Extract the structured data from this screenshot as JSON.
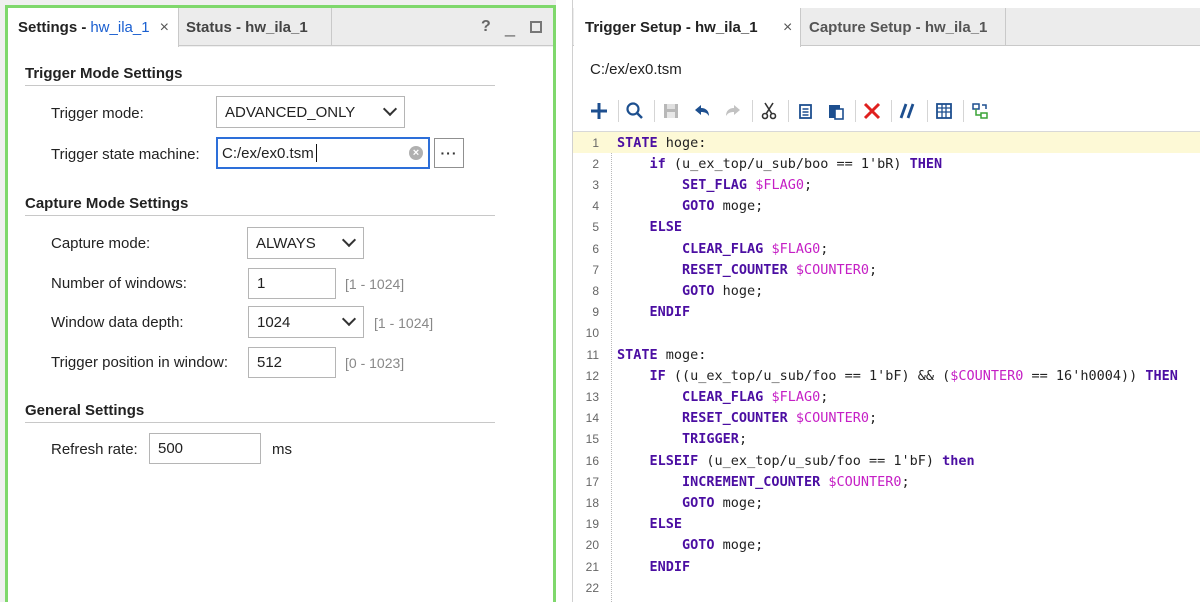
{
  "left": {
    "tabs": {
      "settings_bold": "Settings - ",
      "settings_link": "hw_ila_1",
      "settings_close": "×",
      "status": "Status - hw_ila_1"
    },
    "window_controls": {
      "help": "?",
      "minimize": "_",
      "maximize": ""
    },
    "trigger_mode_settings": {
      "title": "Trigger Mode Settings",
      "trigger_mode_label": "Trigger mode:",
      "trigger_mode_value": "ADVANCED_ONLY",
      "tsm_label": "Trigger state machine:",
      "tsm_value": "C:/ex/ex0.tsm",
      "tsm_clear": "×",
      "browse": "···"
    },
    "capture_mode_settings": {
      "title": "Capture Mode Settings",
      "capture_mode_label": "Capture mode:",
      "capture_mode_value": "ALWAYS",
      "num_windows_label": "Number of windows:",
      "num_windows_value": "1",
      "num_windows_range": "[1 - 1024]",
      "depth_label": "Window data depth:",
      "depth_value": "1024",
      "depth_range": "[1 - 1024]",
      "trigger_pos_label": "Trigger position in window:",
      "trigger_pos_value": "512",
      "trigger_pos_range": "[0 - 1023]"
    },
    "general_settings": {
      "title": "General Settings",
      "refresh_label": "Refresh rate:",
      "refresh_value": "500",
      "refresh_unit": "ms"
    }
  },
  "right": {
    "tabs": {
      "trigger_setup": "Trigger Setup - hw_ila_1",
      "trigger_close": "×",
      "capture_setup": "Capture Setup - hw_ila_1"
    },
    "file_path": "C:/ex/ex0.tsm",
    "toolbar": [
      "add-icon",
      "search-icon",
      "save-icon",
      "undo-icon",
      "redo-icon",
      "cut-icon",
      "copy-icon",
      "paste-icon",
      "delete-icon",
      "comment-icon",
      "columns-icon",
      "settings-icon"
    ],
    "code_lines": [
      {
        "n": "1",
        "tokens": [
          [
            "kw",
            "STATE"
          ],
          [
            "tx",
            " hoge:"
          ]
        ]
      },
      {
        "n": "2",
        "tokens": [
          [
            "tx",
            "    "
          ],
          [
            "kw",
            "if"
          ],
          [
            "tx",
            " (u_ex_top/u_sub/boo == 1'bR) "
          ],
          [
            "kw",
            "THEN"
          ]
        ]
      },
      {
        "n": "3",
        "tokens": [
          [
            "tx",
            "        "
          ],
          [
            "kw",
            "SET_FLAG"
          ],
          [
            "tx",
            " "
          ],
          [
            "mg",
            "$FLAG0"
          ],
          [
            "tx",
            ";"
          ]
        ]
      },
      {
        "n": "4",
        "tokens": [
          [
            "tx",
            "        "
          ],
          [
            "kw",
            "GOTO"
          ],
          [
            "tx",
            " moge;"
          ]
        ]
      },
      {
        "n": "5",
        "tokens": [
          [
            "tx",
            "    "
          ],
          [
            "kw",
            "ELSE"
          ]
        ]
      },
      {
        "n": "6",
        "tokens": [
          [
            "tx",
            "        "
          ],
          [
            "kw",
            "CLEAR_FLAG"
          ],
          [
            "tx",
            " "
          ],
          [
            "mg",
            "$FLAG0"
          ],
          [
            "tx",
            ";"
          ]
        ]
      },
      {
        "n": "7",
        "tokens": [
          [
            "tx",
            "        "
          ],
          [
            "kw",
            "RESET_COUNTER"
          ],
          [
            "tx",
            " "
          ],
          [
            "mg",
            "$COUNTER0"
          ],
          [
            "tx",
            ";"
          ]
        ]
      },
      {
        "n": "8",
        "tokens": [
          [
            "tx",
            "        "
          ],
          [
            "kw",
            "GOTO"
          ],
          [
            "tx",
            " hoge;"
          ]
        ]
      },
      {
        "n": "9",
        "tokens": [
          [
            "tx",
            "    "
          ],
          [
            "kw",
            "ENDIF"
          ]
        ]
      },
      {
        "n": "10",
        "tokens": []
      },
      {
        "n": "11",
        "tokens": [
          [
            "kw",
            "STATE"
          ],
          [
            "tx",
            " moge:"
          ]
        ]
      },
      {
        "n": "12",
        "tokens": [
          [
            "tx",
            "    "
          ],
          [
            "kw",
            "IF"
          ],
          [
            "tx",
            " ((u_ex_top/u_sub/foo == 1'bF) && ("
          ],
          [
            "mg",
            "$COUNTER0"
          ],
          [
            "tx",
            " == 16'h0004)) "
          ],
          [
            "kw",
            "THEN"
          ]
        ]
      },
      {
        "n": "13",
        "tokens": [
          [
            "tx",
            "        "
          ],
          [
            "kw",
            "CLEAR_FLAG"
          ],
          [
            "tx",
            " "
          ],
          [
            "mg",
            "$FLAG0"
          ],
          [
            "tx",
            ";"
          ]
        ]
      },
      {
        "n": "14",
        "tokens": [
          [
            "tx",
            "        "
          ],
          [
            "kw",
            "RESET_COUNTER"
          ],
          [
            "tx",
            " "
          ],
          [
            "mg",
            "$COUNTER0"
          ],
          [
            "tx",
            ";"
          ]
        ]
      },
      {
        "n": "15",
        "tokens": [
          [
            "tx",
            "        "
          ],
          [
            "kw",
            "TRIGGER"
          ],
          [
            "tx",
            ";"
          ]
        ]
      },
      {
        "n": "16",
        "tokens": [
          [
            "tx",
            "    "
          ],
          [
            "kw",
            "ELSEIF"
          ],
          [
            "tx",
            " (u_ex_top/u_sub/foo == 1'bF) "
          ],
          [
            "kw",
            "then"
          ]
        ]
      },
      {
        "n": "17",
        "tokens": [
          [
            "tx",
            "        "
          ],
          [
            "kw",
            "INCREMENT_COUNTER"
          ],
          [
            "tx",
            " "
          ],
          [
            "mg",
            "$COUNTER0"
          ],
          [
            "tx",
            ";"
          ]
        ]
      },
      {
        "n": "18",
        "tokens": [
          [
            "tx",
            "        "
          ],
          [
            "kw",
            "GOTO"
          ],
          [
            "tx",
            " moge;"
          ]
        ]
      },
      {
        "n": "19",
        "tokens": [
          [
            "tx",
            "    "
          ],
          [
            "kw",
            "ELSE"
          ]
        ]
      },
      {
        "n": "20",
        "tokens": [
          [
            "tx",
            "        "
          ],
          [
            "kw",
            "GOTO"
          ],
          [
            "tx",
            " moge;"
          ]
        ]
      },
      {
        "n": "21",
        "tokens": [
          [
            "tx",
            "    "
          ],
          [
            "kw",
            "ENDIF"
          ]
        ]
      },
      {
        "n": "22",
        "tokens": []
      }
    ]
  },
  "colors": {
    "accent_green": "#7fd86c",
    "link_blue": "#1a5fd0",
    "keyword": "#4b0ea2",
    "variable": "#c51fc5",
    "active_line": "#fdf9d6"
  }
}
